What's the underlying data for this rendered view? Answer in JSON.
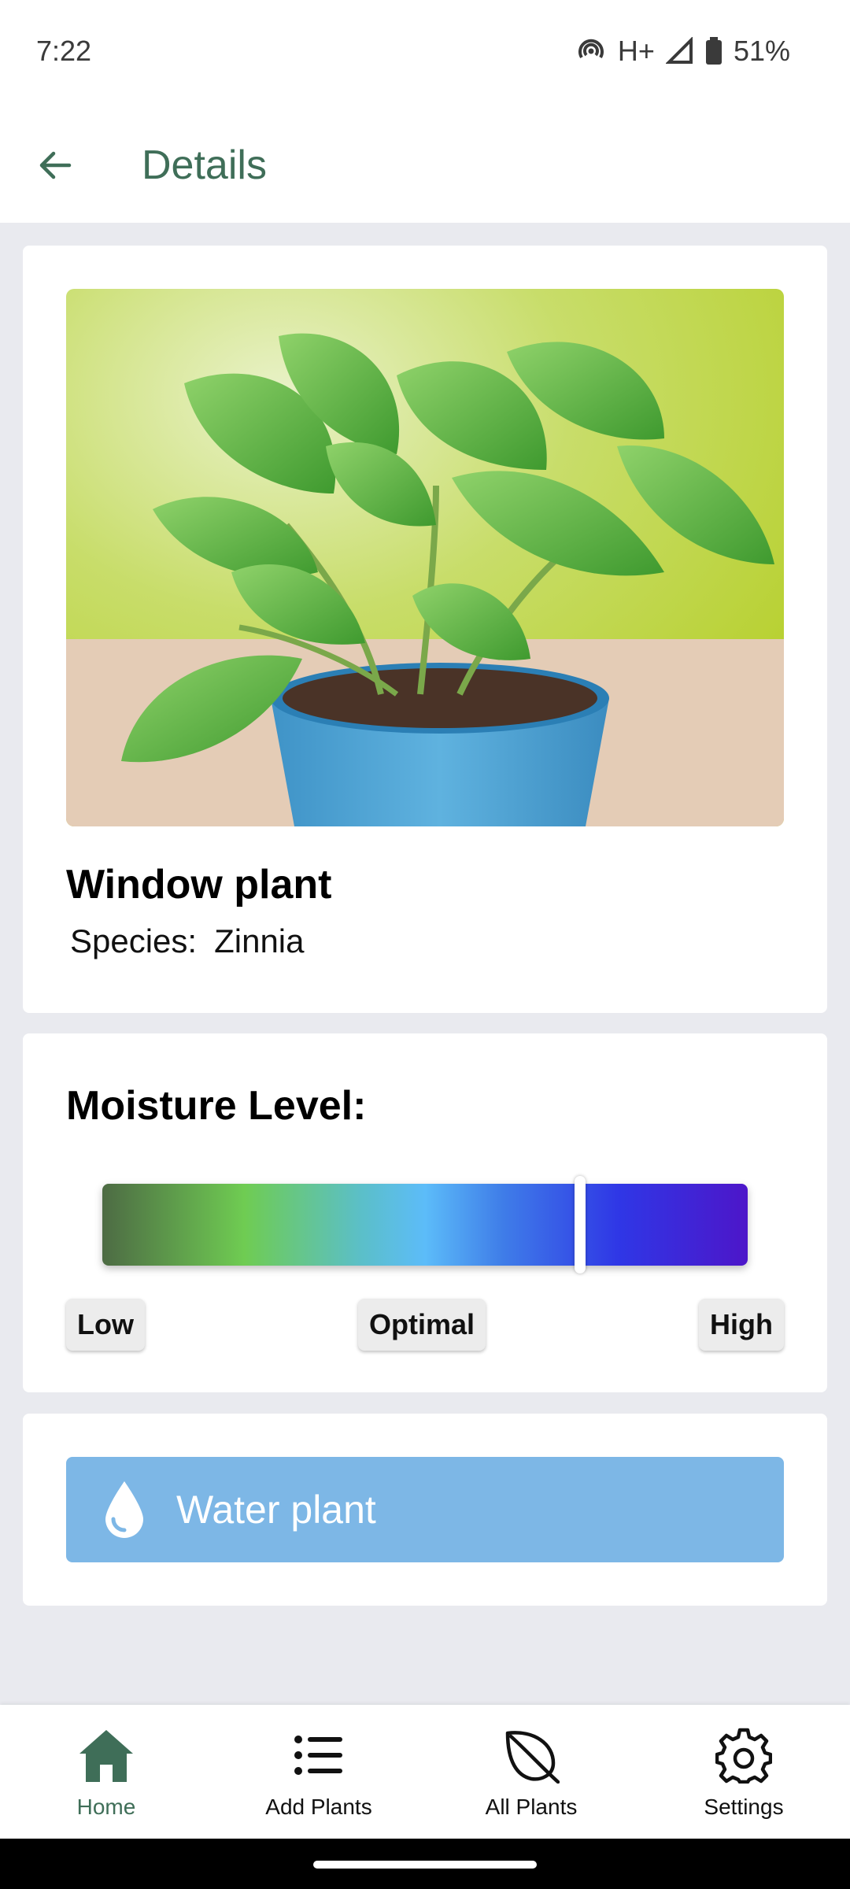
{
  "status_bar": {
    "time": "7:22",
    "network": "H+",
    "battery": "51%"
  },
  "app_bar": {
    "title": "Details",
    "back_icon": "arrow-left-icon"
  },
  "plant": {
    "name": "Window plant",
    "species_label": "Species:",
    "species_value": "Zinnia"
  },
  "moisture": {
    "title": "Moisture Level:",
    "level_fraction": 0.74,
    "labels": {
      "low": "Low",
      "optimal": "Optimal",
      "high": "High"
    }
  },
  "water": {
    "label": "Water plant",
    "icon": "water-drop-icon",
    "color": "#7db7e6"
  },
  "bottom_nav": {
    "items": [
      {
        "label": "Home",
        "icon": "home-icon",
        "active": true
      },
      {
        "label": "Add Plants",
        "icon": "list-icon",
        "active": false
      },
      {
        "label": "All Plants",
        "icon": "leaf-icon",
        "active": false
      },
      {
        "label": "Settings",
        "icon": "gear-icon",
        "active": false
      }
    ]
  },
  "colors": {
    "accent": "#3f6e58",
    "background": "#e9eaef"
  }
}
